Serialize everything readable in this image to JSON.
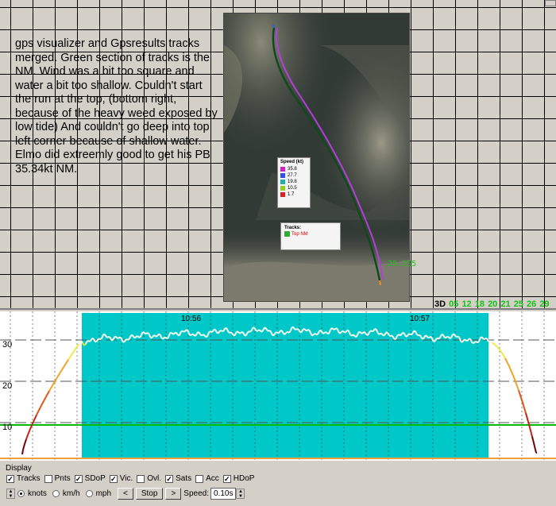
{
  "note": {
    "text": "gps visualizer and Gpsresults tracks merged. Green section of tracks is the NM. Wind was a bit too square and water a bit too shallow. Couldn't start the run at the top, (bottom right, because of the heavy weed exposed by low tide) And couldn't go deep into top left corner because of shallow water.\nElmo did extreemly good to get his PB 35.34kt NM."
  },
  "map": {
    "legend_title": "Speed (kt)",
    "legend": [
      {
        "label": "35.8",
        "color": "#d020d0"
      },
      {
        "label": "27.7",
        "color": "#3050f0"
      },
      {
        "label": "19.8",
        "color": "#20b0b0"
      },
      {
        "label": "10.5",
        "color": "#90d020"
      },
      {
        "label": "1.7",
        "color": "#e02020"
      }
    ],
    "tracks_title": "Tracks:",
    "track_name": "Top NM",
    "position_label": "29.235"
  },
  "satellites": {
    "mode": "3D",
    "ids": [
      "05",
      "12",
      "18",
      "20",
      "21",
      "25",
      "26",
      "29"
    ]
  },
  "graph": {
    "y_ticks": [
      "30",
      "20",
      "10"
    ],
    "time_labels": [
      "10:56",
      "10:57"
    ],
    "threshold_value": 10,
    "colors": {
      "selection": "#00c8c8",
      "threshold": "#00bb00",
      "baseline": "#f0a040"
    }
  },
  "controls": {
    "display_label": "Display",
    "checkboxes": [
      {
        "label": "Tracks",
        "checked": true
      },
      {
        "label": "Pnts",
        "checked": false
      },
      {
        "label": "SDoP",
        "checked": true
      },
      {
        "label": "Vic.",
        "checked": true
      },
      {
        "label": "Ovl.",
        "checked": false
      },
      {
        "label": "Sats",
        "checked": true
      },
      {
        "label": "Acc",
        "checked": false
      },
      {
        "label": "HDoP",
        "checked": true
      }
    ],
    "units": [
      {
        "label": "knots",
        "selected": true
      },
      {
        "label": "km/h",
        "selected": false
      },
      {
        "label": "mph",
        "selected": false
      }
    ],
    "prev_label": "<",
    "stop_label": "Stop",
    "next_label": ">",
    "speed_label": "Speed:",
    "speed_value": "0.10s"
  }
}
